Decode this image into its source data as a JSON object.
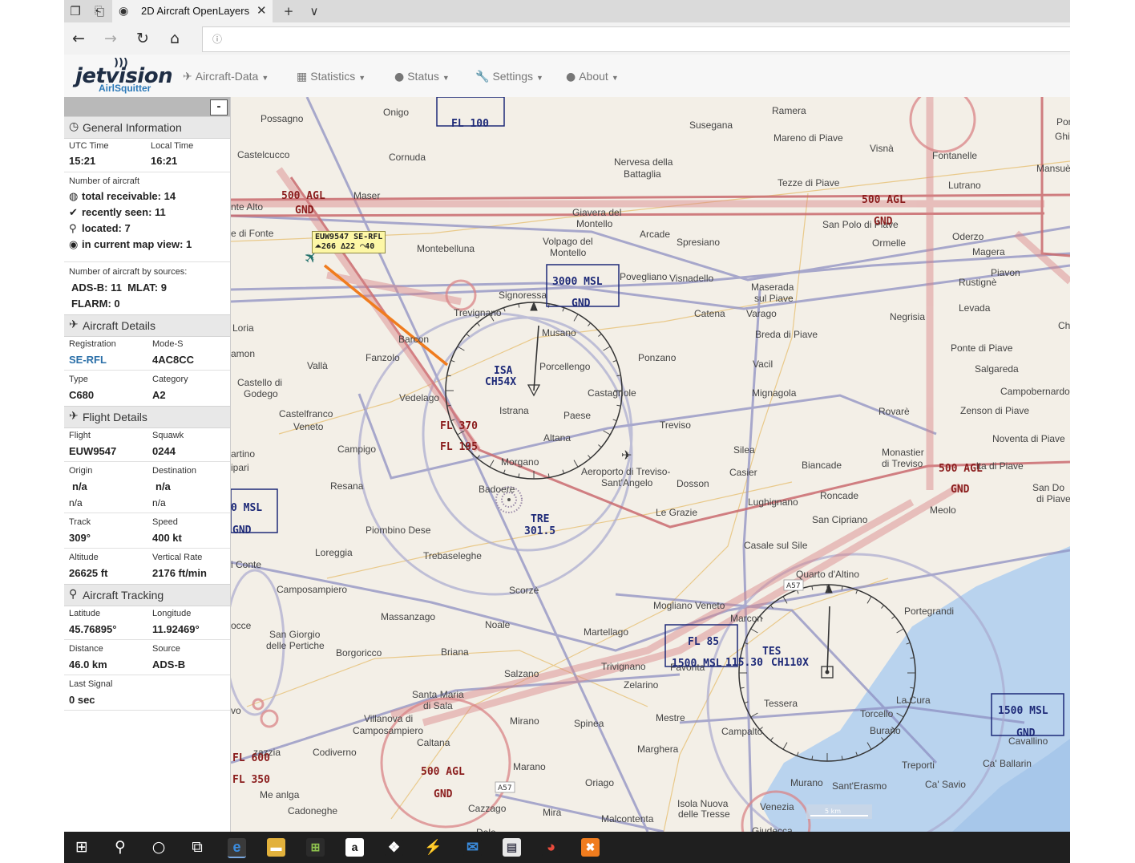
{
  "browser": {
    "tab_title": "2D Aircraft OpenLayers",
    "tab_close": "✕",
    "new_tab": "+",
    "tab_menu": "∨"
  },
  "app_nav": {
    "logo_name": "jetvision",
    "logo_sub": "AirlSquitter",
    "menus": [
      {
        "icon": "plane-icon",
        "label": "Aircraft-Data"
      },
      {
        "icon": "bar-chart-icon",
        "label": "Statistics"
      },
      {
        "icon": "info-circle-icon",
        "label": "Status"
      },
      {
        "icon": "wrench-icon",
        "label": "Settings"
      },
      {
        "icon": "question-circle-icon",
        "label": "About"
      }
    ]
  },
  "sidebar": {
    "collapse_label": "-",
    "general": {
      "title": "General Information",
      "utc_time_label": "UTC Time",
      "utc_time": "15:21",
      "local_time_label": "Local Time",
      "local_time": "16:21",
      "num_aircraft_label": "Number of aircraft",
      "total_receivable": "total receivable: 14",
      "recently_seen": "recently seen: 11",
      "located": "located: 7",
      "in_map_view": "in current map view: 1",
      "by_sources_label": "Number of aircraft by sources:",
      "adsb_mlat": "ADS-B: 11  MLAT: 9",
      "flarm": "FLARM: 0"
    },
    "aircraft_details": {
      "title": "Aircraft Details",
      "registration_label": "Registration",
      "registration": "SE-RFL",
      "modes_label": "Mode-S",
      "modes": "4AC8CC",
      "type_label": "Type",
      "type": "C680",
      "category_label": "Category",
      "category": "A2"
    },
    "flight_details": {
      "title": "Flight Details",
      "flight_label": "Flight",
      "flight": "EUW9547",
      "squawk_label": "Squawk",
      "squawk": "0244",
      "origin_label": "Origin",
      "origin": "n/a",
      "origin_sub": "n/a",
      "destination_label": "Destination",
      "destination": "n/a",
      "destination_sub": "n/a",
      "track_label": "Track",
      "track": "309°",
      "speed_label": "Speed",
      "speed": "400 kt",
      "altitude_label": "Altitude",
      "altitude": "26625 ft",
      "vrate_label": "Vertical Rate",
      "vrate": "2176 ft/min"
    },
    "tracking": {
      "title": "Aircraft Tracking",
      "lat_label": "Latitude",
      "lat": "45.76895°",
      "lon_label": "Longitude",
      "lon": "11.92469°",
      "distance_label": "Distance",
      "distance": "46.0 km",
      "source_label": "Source",
      "source": "ADS-B",
      "last_signal_label": "Last Signal",
      "last_signal": "0 sec"
    }
  },
  "map": {
    "aircraft_label": "EUW9547 SE-RFL",
    "aircraft_info": "⏶266 ∆22 ◠40",
    "places": [
      [
        "Possagno",
        37,
        20
      ],
      [
        "Onigo",
        190,
        12
      ],
      [
        "Susegana",
        572,
        28
      ],
      [
        "Ramera",
        675,
        10
      ],
      [
        "Portobuffolè",
        1030,
        24
      ],
      [
        "Ghirano",
        1028,
        42
      ],
      [
        "Castelcucco",
        8,
        65
      ],
      [
        "Cornuda",
        197,
        68
      ],
      [
        "Nervesa della",
        478,
        74
      ],
      [
        "Battaglia",
        490,
        89
      ],
      [
        "Visnà",
        797,
        57
      ],
      [
        "Fontanelle",
        875,
        66
      ],
      [
        "Mansuè",
        1005,
        82
      ],
      [
        "Mareno di Piave",
        677,
        44
      ],
      [
        "Tezze di Piave",
        682,
        100
      ],
      [
        "Lutrano",
        895,
        103
      ],
      [
        "Maser",
        153,
        116
      ],
      [
        "nte Alto",
        0,
        130
      ],
      [
        "Giavera del",
        426,
        137
      ],
      [
        "Montello",
        431,
        151
      ],
      [
        "San Polo di Piave",
        738,
        152
      ],
      [
        "Arcade",
        510,
        164
      ],
      [
        "Spresiano",
        556,
        174
      ],
      [
        "Ormelle",
        800,
        175
      ],
      [
        "Oderzo",
        900,
        167
      ],
      [
        "e di Fonte",
        0,
        163
      ],
      [
        "Montebelluna",
        232,
        182
      ],
      [
        "Volpago del",
        389,
        173
      ],
      [
        "Montello",
        398,
        187
      ],
      [
        "Magera",
        925,
        186
      ],
      [
        "Piavon",
        948,
        212
      ],
      [
        "Povegliano",
        485,
        217
      ],
      [
        "Visnadello",
        547,
        219
      ],
      [
        "Maserada",
        649,
        230
      ],
      [
        "sul Piave",
        653,
        244
      ],
      [
        "Rustignè",
        908,
        224
      ],
      [
        "Signoressa",
        334,
        240
      ],
      [
        "Catena",
        578,
        263
      ],
      [
        "Varago",
        643,
        263
      ],
      [
        "Levada",
        908,
        256
      ],
      [
        "Negrisia",
        822,
        267
      ],
      [
        "Trevignano",
        278,
        262
      ],
      [
        "Loria",
        2,
        281
      ],
      [
        "Musano",
        388,
        287
      ],
      [
        "Breda di Piave",
        654,
        289
      ],
      [
        "Ch",
        1032,
        278
      ],
      [
        "Barcon",
        209,
        295
      ],
      [
        "amon",
        0,
        313
      ],
      [
        "Fanzolo",
        168,
        318
      ],
      [
        "Porcellengo",
        385,
        329
      ],
      [
        "Ponzano",
        508,
        318
      ],
      [
        "Ponte di Piave",
        898,
        306
      ],
      [
        "Vallà",
        95,
        328
      ],
      [
        "Vacil",
        651,
        326
      ],
      [
        "Salgareda",
        928,
        332
      ],
      [
        "Castello di",
        8,
        349
      ],
      [
        "Godego",
        16,
        363
      ],
      [
        "Castagnole",
        445,
        362
      ],
      [
        "Mignagola",
        650,
        362
      ],
      [
        "Campobernardo",
        960,
        360
      ],
      [
        "Vedelago",
        210,
        368
      ],
      [
        "Istrana",
        335,
        384
      ],
      [
        "Rovarè",
        808,
        385
      ],
      [
        "Zenson di Piave",
        910,
        384
      ],
      [
        "Paese",
        415,
        390
      ],
      [
        "Treviso",
        535,
        402
      ],
      [
        "Altana",
        390,
        418
      ],
      [
        "Silea",
        627,
        433
      ],
      [
        "Noventa di Piave",
        950,
        419
      ],
      [
        "Castelfranco",
        60,
        388
      ],
      [
        "Veneto",
        78,
        404
      ],
      [
        "Campigo",
        133,
        432
      ],
      [
        "Morgano",
        337,
        448
      ],
      [
        "Casier",
        622,
        461
      ],
      [
        "Biancade",
        712,
        452
      ],
      [
        "Monastier",
        812,
        436
      ],
      [
        "di Treviso",
        812,
        450
      ],
      [
        "San Do",
        1000,
        480
      ],
      [
        "di Piave",
        1005,
        494
      ],
      [
        "artino",
        0,
        438
      ],
      [
        "ipari",
        0,
        455
      ],
      [
        "Aeroporto di Treviso-",
        437,
        460
      ],
      [
        "Sant'Angelo",
        462,
        474
      ],
      [
        "Dosson",
        556,
        475
      ],
      [
        "Roncade",
        735,
        490
      ],
      [
        "lta di Piave",
        930,
        453
      ],
      [
        "Resana",
        124,
        478
      ],
      [
        "Badoere",
        309,
        482
      ],
      [
        "Lughignano",
        645,
        498
      ],
      [
        "Meolo",
        872,
        508
      ],
      [
        "Le Grazie",
        530,
        511
      ],
      [
        "San Cipriano",
        725,
        520
      ],
      [
        "Piombino Dese",
        168,
        533
      ],
      [
        "Loreggia",
        105,
        561
      ],
      [
        "Trebaseleghe",
        240,
        565
      ],
      [
        "Casale sul Sile",
        640,
        552
      ],
      [
        "Quarto d'Altino",
        705,
        588
      ],
      [
        "i Conte",
        0,
        576
      ],
      [
        "Camposampiero",
        57,
        607
      ],
      [
        "Scorzè",
        347,
        608
      ],
      [
        "Portegrandi",
        840,
        634
      ],
      [
        "Mogliano Veneto",
        527,
        627
      ],
      [
        "Massanzago",
        187,
        641
      ],
      [
        "Noale",
        317,
        651
      ],
      [
        "Marcon",
        623,
        643
      ],
      [
        "occe",
        0,
        652
      ],
      [
        "San Giorgio",
        48,
        663
      ],
      [
        "delle Pertiche",
        44,
        677
      ],
      [
        "Martellago",
        440,
        660
      ],
      [
        "Borgoricco",
        131,
        686
      ],
      [
        "Briana",
        262,
        685
      ],
      [
        "Trivignano",
        462,
        703
      ],
      [
        "Favorita",
        548,
        704
      ],
      [
        "Salzano",
        341,
        712
      ],
      [
        "Zelarino",
        490,
        726
      ],
      [
        "vo",
        0,
        758
      ],
      [
        "Santa Maria",
        226,
        738
      ],
      [
        "di Sala",
        240,
        752
      ],
      [
        "Mirano",
        348,
        771
      ],
      [
        "Spinea",
        428,
        774
      ],
      [
        "Mestre",
        530,
        767
      ],
      [
        "Tessera",
        665,
        749
      ],
      [
        "La Cura",
        830,
        745
      ],
      [
        "Torcello",
        785,
        762
      ],
      [
        "Burano",
        797,
        783
      ],
      [
        "Villanova di",
        166,
        768
      ],
      [
        "Camposampiero",
        152,
        783
      ],
      [
        "Caltana",
        232,
        798
      ],
      [
        "Campalto",
        612,
        784
      ],
      [
        "Marghera",
        507,
        806
      ],
      [
        "Treporti",
        837,
        826
      ],
      [
        "Ca' Ballarin",
        938,
        824
      ],
      [
        "Cavallino",
        970,
        796
      ],
      [
        "zazzia",
        28,
        810
      ],
      [
        "Codiverno",
        102,
        810
      ],
      [
        "Marano",
        352,
        828
      ],
      [
        "Oriago",
        442,
        848
      ],
      [
        "Murano",
        698,
        848
      ],
      [
        "Sant'Erasmo",
        750,
        852
      ],
      [
        "Ca' Savio",
        866,
        850
      ],
      [
        "Me anlga",
        36,
        863
      ],
      [
        "Cadoneghe",
        71,
        883
      ],
      [
        "Cazzago",
        296,
        880
      ],
      [
        "Mira",
        389,
        885
      ],
      [
        "Malcontenta",
        462,
        893
      ],
      [
        "Venezia",
        660,
        878
      ],
      [
        "Isola Nuova",
        557,
        874
      ],
      [
        "delle Tresse",
        558,
        887
      ],
      [
        "Dolo",
        306,
        910
      ],
      [
        "Giudecca",
        650,
        908
      ]
    ],
    "airspace_labels": [
      [
        "FL 100",
        275,
        25,
        "navy"
      ],
      [
        "500 AGL",
        63,
        115,
        "maroon"
      ],
      [
        "GND",
        80,
        133,
        "maroon"
      ],
      [
        "500 AGL",
        787,
        120,
        "maroon"
      ],
      [
        "GND",
        802,
        147,
        "maroon"
      ],
      [
        "3000 MSL",
        401,
        222,
        "navy"
      ],
      [
        "GND",
        425,
        249,
        "navy"
      ],
      [
        "ISA",
        328,
        333,
        "navy"
      ],
      [
        "CH54X",
        317,
        347,
        "navy"
      ],
      [
        "FL 370",
        261,
        402,
        "maroon"
      ],
      [
        "FL 195",
        261,
        428,
        "maroon"
      ],
      [
        "500 AGL",
        883,
        455,
        "maroon"
      ],
      [
        "GND",
        898,
        481,
        "maroon"
      ],
      [
        "0 MSL",
        0,
        504,
        "navy"
      ],
      [
        "GND",
        2,
        532,
        "navy"
      ],
      [
        "TRE",
        374,
        518,
        "navy"
      ],
      [
        "301.5",
        366,
        533,
        "navy"
      ],
      [
        "FL 85",
        570,
        671,
        "navy"
      ],
      [
        "1500 MSL",
        550,
        698,
        "navy"
      ],
      [
        "115.30",
        617,
        697,
        "navy"
      ],
      [
        "TES",
        663,
        683,
        "navy"
      ],
      [
        "CH110X",
        674,
        697,
        "navy"
      ],
      [
        "1500 MSL",
        957,
        757,
        "navy"
      ],
      [
        "GND",
        980,
        785,
        "navy"
      ],
      [
        "FL 600",
        2,
        816,
        "maroon"
      ],
      [
        "FL 350",
        2,
        843,
        "maroon"
      ],
      [
        "500 AGL",
        237,
        833,
        "maroon"
      ],
      [
        "GND",
        253,
        861,
        "maroon"
      ]
    ],
    "roads": [
      [
        "A57",
        692,
        603
      ],
      [
        "A57",
        332,
        855
      ]
    ],
    "scale_label": "5 km"
  },
  "taskbar": {
    "amazon_label": "a"
  }
}
